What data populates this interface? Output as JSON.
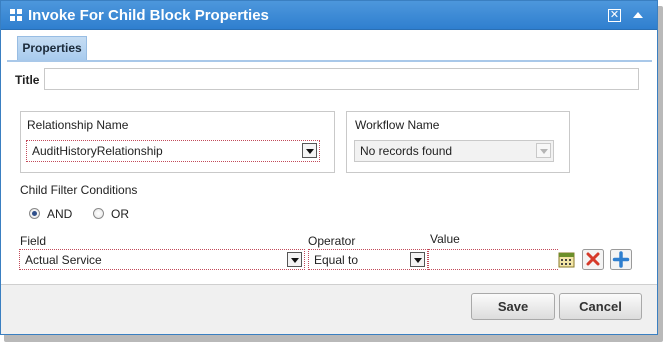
{
  "dialog": {
    "title": "Invoke For Child Block Properties"
  },
  "tabs": [
    {
      "label": "Properties",
      "active": true
    }
  ],
  "form": {
    "title_label": "Title",
    "title_value": "",
    "relationship": {
      "label": "Relationship Name",
      "value": "AuditHistoryRelationship"
    },
    "workflow": {
      "label": "Workflow Name",
      "value": "No records found",
      "disabled": true
    },
    "child_filter": {
      "label": "Child Filter Conditions",
      "options": [
        {
          "label": "AND",
          "selected": true
        },
        {
          "label": "OR",
          "selected": false
        }
      ]
    },
    "condition": {
      "field_label": "Field",
      "field_value": "Actual Service",
      "operator_label": "Operator",
      "operator_value": "Equal to",
      "value_label": "Value",
      "value": ""
    }
  },
  "footer": {
    "save_label": "Save",
    "cancel_label": "Cancel"
  },
  "colors": {
    "titlebar": "#3a8ad6",
    "tab_active": "#b8d5f1",
    "required_border": "#c24a5a",
    "delete_icon": "#d63a2a",
    "add_icon": "#2f7fcf"
  }
}
